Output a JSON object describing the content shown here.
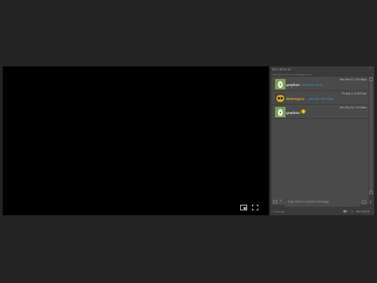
{
  "video": {
    "pip_icon": "picture-in-picture-icon",
    "fullscreen_icon": "fullscreen-icon"
  },
  "chat": {
    "title": "the drive-in",
    "url": "http://the-drive-in.chatango.com",
    "close_label": "×",
    "messages": [
      {
        "user": "grayfoxx:",
        "text": "and were back",
        "timestamp": "Mon Mar 27, 1:20:28pm",
        "user_color": "#e8e8e8",
        "avatar": "cat-avatar"
      },
      {
        "user": "85J9rtegory:",
        "text": "and this still exists",
        "timestamp": "Fri Aug 11, 8:16:37pm",
        "user_color": "#e0a82e",
        "avatar": "bug-avatar"
      },
      {
        "user": "grayfoxx:",
        "text": "",
        "timestamp": "Mon Sep 25, 1:15:28am",
        "user_color": "#e8e8e8",
        "avatar": "cat-avatar",
        "emoji": "smiley-emoji"
      }
    ],
    "input_placeholder": "Type here to send a message",
    "footer_brand": "Chatango",
    "set_name_label": "Set name",
    "user_count": "1"
  }
}
